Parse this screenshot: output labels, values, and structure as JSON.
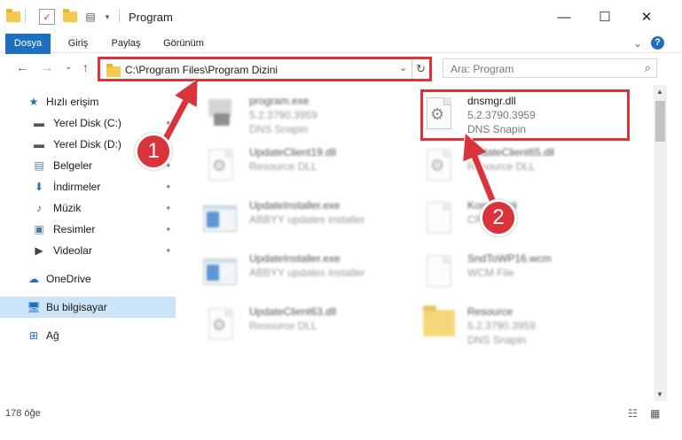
{
  "window": {
    "title": "Program",
    "minimize": "—",
    "maximize": "☐",
    "close": "✕"
  },
  "ribbon": {
    "tabs": [
      "Dosya",
      "Giriş",
      "Paylaş",
      "Görünüm"
    ],
    "expand": "⌄",
    "help": "?"
  },
  "nav": {
    "back": "←",
    "forward": "→",
    "recent": "⌄",
    "up": "↑",
    "address": "C:\\Program Files\\Program Dizini",
    "address_dropdown": "⌄",
    "refresh": "↻",
    "search_placeholder": "Ara: Program",
    "search_icon": "⌕"
  },
  "sidebar": {
    "items": [
      {
        "label": "Hızlı erişim",
        "icon": "star-icon",
        "glyph": "★",
        "color": "#1f6fbf"
      },
      {
        "label": "Yerel Disk (C:)",
        "icon": "drive-icon",
        "glyph": "▬",
        "color": "#555555",
        "pinned": true
      },
      {
        "label": "Yerel Disk (D:)",
        "icon": "drive-icon",
        "glyph": "▬",
        "color": "#555555",
        "pinned": true
      },
      {
        "label": "Belgeler",
        "icon": "documents-icon",
        "glyph": "▤",
        "color": "#4a7ab0",
        "pinned": true
      },
      {
        "label": "İndirmeler",
        "icon": "download-icon",
        "glyph": "⬇",
        "color": "#1f6fbf",
        "pinned": true
      },
      {
        "label": "Müzik",
        "icon": "music-icon",
        "glyph": "♪",
        "color": "#1f6fbf",
        "pinned": true
      },
      {
        "label": "Resimler",
        "icon": "pictures-icon",
        "glyph": "▣",
        "color": "#4a7ab0",
        "pinned": true
      },
      {
        "label": "Videolar",
        "icon": "videos-icon",
        "glyph": "▶",
        "color": "#444444",
        "pinned": true
      },
      {
        "label": "OneDrive",
        "icon": "cloud-icon",
        "glyph": "☁",
        "color": "#1f6fbf"
      },
      {
        "label": "Bu bilgisayar",
        "icon": "computer-icon",
        "glyph": "🖥",
        "color": "#1f6fbf",
        "selected": true
      },
      {
        "label": "Ağ",
        "icon": "network-icon",
        "glyph": "⊞",
        "color": "#1f6fbf"
      }
    ],
    "pin_glyph": "📌"
  },
  "files": [
    {
      "name": "program.exe",
      "meta1": "5.2.3790.3959",
      "meta2": "DNS Snapin",
      "kind": "program",
      "blurred": true
    },
    {
      "name": "dnsmgr.dll",
      "meta1": "5.2.3790.3959",
      "meta2": "DNS Snapin",
      "kind": "dll",
      "blurred": false
    },
    {
      "name": "UpdateClient19.dll",
      "meta1": "Resource DLL",
      "meta2": "",
      "kind": "dll",
      "blurred": true
    },
    {
      "name": "UpdateClient65.dll",
      "meta1": "Resource DLL",
      "meta2": "",
      "kind": "dll",
      "blurred": true
    },
    {
      "name": "UpdateInstaller.exe",
      "meta1": "ABBYY updates installer",
      "meta2": "",
      "kind": "winapp",
      "blurred": true
    },
    {
      "name": "Konuşmali",
      "meta1": "CRT",
      "meta2": "",
      "kind": "blank",
      "blurred": true
    },
    {
      "name": "UpdateInstaller.exe",
      "meta1": "ABBYY updates installer",
      "meta2": "",
      "kind": "winapp",
      "blurred": true
    },
    {
      "name": "SndToWP16.wcm",
      "meta1": "WCM File",
      "meta2": "",
      "kind": "blank",
      "blurred": true
    },
    {
      "name": "UpdateClient63.dll",
      "meta1": "Resource DLL",
      "meta2": "",
      "kind": "dll",
      "blurred": true
    },
    {
      "name": "Resource",
      "meta1": "5.2.3790.3959",
      "meta2": "DNS Snapin",
      "kind": "folder",
      "blurred": true
    }
  ],
  "status": {
    "count": "178 öğe",
    "details_view": "☷",
    "tiles_view": "▦"
  },
  "annotations": {
    "badge1": "1",
    "badge2": "2",
    "accent": "#d9343b"
  },
  "colors": {
    "file_tab": "#1f6fbf",
    "selected_sidebar": "#cce4f7"
  }
}
